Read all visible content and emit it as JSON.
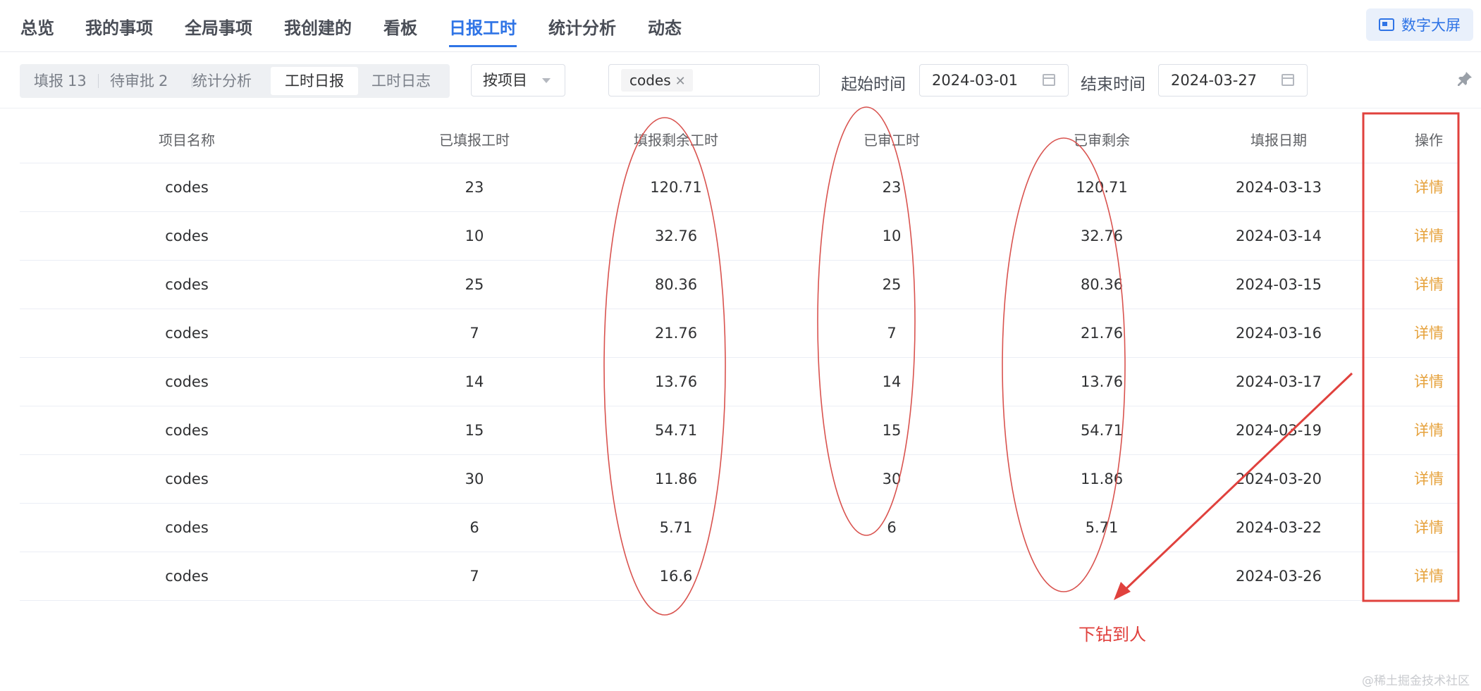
{
  "nav": {
    "tabs": [
      {
        "label": "总览"
      },
      {
        "label": "我的事项"
      },
      {
        "label": "全局事项"
      },
      {
        "label": "我创建的"
      },
      {
        "label": "看板"
      },
      {
        "label": "日报工时"
      },
      {
        "label": "统计分析"
      },
      {
        "label": "动态"
      }
    ],
    "active_tab": "日报工时",
    "big_screen_label": "数字大屏"
  },
  "filter": {
    "segments": [
      {
        "label": "填报",
        "count": "13"
      },
      {
        "label": "待审批",
        "count": "2"
      },
      {
        "label": "统计分析"
      },
      {
        "label": "工时日报"
      },
      {
        "label": "工时日志"
      }
    ],
    "active_segment": "工时日报",
    "group_by": "按项目",
    "project_tag": "codes",
    "start_label": "起始时间",
    "start_date": "2024-03-01",
    "end_label": "结束时间",
    "end_date": "2024-03-27"
  },
  "table": {
    "columns": [
      "项目名称",
      "已填报工时",
      "填报剩余工时",
      "已审工时",
      "已审剩余",
      "填报日期",
      "操作"
    ],
    "rows": [
      {
        "project": "codes",
        "filled": "23",
        "fill_remaining": "120.71",
        "approved": "23",
        "approved_remaining": "120.71",
        "date": "2024-03-13",
        "action": "详情"
      },
      {
        "project": "codes",
        "filled": "10",
        "fill_remaining": "32.76",
        "approved": "10",
        "approved_remaining": "32.76",
        "date": "2024-03-14",
        "action": "详情"
      },
      {
        "project": "codes",
        "filled": "25",
        "fill_remaining": "80.36",
        "approved": "25",
        "approved_remaining": "80.36",
        "date": "2024-03-15",
        "action": "详情"
      },
      {
        "project": "codes",
        "filled": "7",
        "fill_remaining": "21.76",
        "approved": "7",
        "approved_remaining": "21.76",
        "date": "2024-03-16",
        "action": "详情"
      },
      {
        "project": "codes",
        "filled": "14",
        "fill_remaining": "13.76",
        "approved": "14",
        "approved_remaining": "13.76",
        "date": "2024-03-17",
        "action": "详情"
      },
      {
        "project": "codes",
        "filled": "15",
        "fill_remaining": "54.71",
        "approved": "15",
        "approved_remaining": "54.71",
        "date": "2024-03-19",
        "action": "详情"
      },
      {
        "project": "codes",
        "filled": "30",
        "fill_remaining": "11.86",
        "approved": "30",
        "approved_remaining": "11.86",
        "date": "2024-03-20",
        "action": "详情"
      },
      {
        "project": "codes",
        "filled": "6",
        "fill_remaining": "5.71",
        "approved": "6",
        "approved_remaining": "5.71",
        "date": "2024-03-22",
        "action": "详情"
      },
      {
        "project": "codes",
        "filled": "7",
        "fill_remaining": "16.6",
        "approved": "",
        "approved_remaining": "",
        "date": "2024-03-26",
        "action": "详情"
      }
    ]
  },
  "annotation": {
    "label": "下钻到人",
    "color": "#e0413d"
  },
  "watermark": "@稀土掘金技术社区",
  "colors": {
    "accent": "#2f74e6",
    "link": "#e6a23c",
    "annotation": "#e0413d"
  }
}
